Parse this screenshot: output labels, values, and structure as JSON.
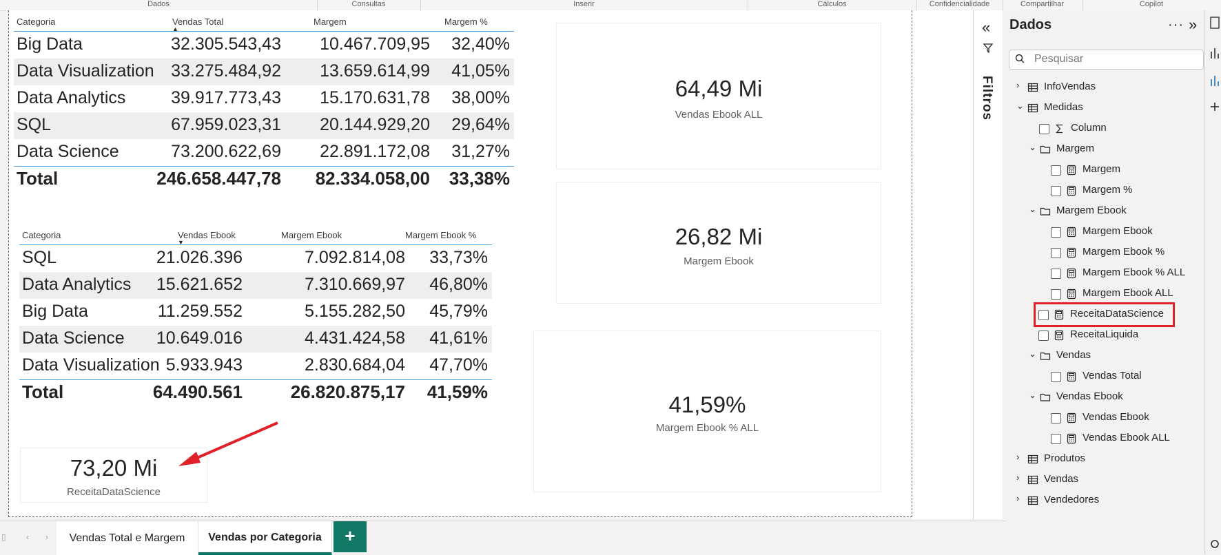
{
  "ribbon": [
    "Dados",
    "Consultas",
    "Inserir",
    "Cálculos",
    "Confidencialidade",
    "Compartilhar",
    "Copilot"
  ],
  "table1": {
    "headers": [
      "Categoria",
      "Vendas Total",
      "Margem",
      "Margem %"
    ],
    "rows": [
      [
        "Big Data",
        "32.305.543,43",
        "10.467.709,95",
        "32,40%"
      ],
      [
        "Data Visualization",
        "33.275.484,92",
        "13.659.614,99",
        "41,05%"
      ],
      [
        "Data Analytics",
        "39.917.773,43",
        "15.170.631,78",
        "38,00%"
      ],
      [
        "SQL",
        "67.959.023,31",
        "20.144.929,20",
        "29,64%"
      ],
      [
        "Data Science",
        "73.200.622,69",
        "22.891.172,08",
        "31,27%"
      ]
    ],
    "total": [
      "Total",
      "246.658.447,78",
      "82.334.058,00",
      "33,38%"
    ]
  },
  "table2": {
    "headers": [
      "Categoria",
      "Vendas Ebook",
      "Margem Ebook",
      "Margem Ebook %"
    ],
    "rows": [
      [
        "SQL",
        "21.026.396",
        "7.092.814,08",
        "33,73%"
      ],
      [
        "Data Analytics",
        "15.621.652",
        "7.310.669,97",
        "46,80%"
      ],
      [
        "Big Data",
        "11.259.552",
        "5.155.282,50",
        "45,79%"
      ],
      [
        "Data Science",
        "10.649.016",
        "4.431.424,58",
        "41,61%"
      ],
      [
        "Data Visualization",
        "5.933.943",
        "2.830.684,04",
        "47,70%"
      ]
    ],
    "total": [
      "Total",
      "64.490.561",
      "26.820.875,17",
      "41,59%"
    ]
  },
  "cards": {
    "vendas_ebook_all": {
      "value": "64,49 Mi",
      "label": "Vendas Ebook ALL"
    },
    "margem_ebook": {
      "value": "26,82 Mi",
      "label": "Margem Ebook"
    },
    "margem_ebook_pct_all": {
      "value": "41,59%",
      "label": "Margem Ebook % ALL"
    },
    "receita_data_science": {
      "value": "73,20 Mi",
      "label": "ReceitaDataScience"
    }
  },
  "filters": {
    "label": "Filtros"
  },
  "data_pane": {
    "title": "Dados",
    "more": "···",
    "search_placeholder": "Pesquisar",
    "tree": [
      {
        "label": "InfoVendas",
        "expander": "›"
      },
      {
        "label": "Medidas",
        "expander": "⌄"
      },
      {
        "label": "Column"
      },
      {
        "label": "Margem",
        "expander": "⌄"
      },
      {
        "label": "Margem"
      },
      {
        "label": "Margem %"
      },
      {
        "label": "Margem Ebook",
        "expander": "⌄"
      },
      {
        "label": "Margem Ebook"
      },
      {
        "label": "Margem Ebook %"
      },
      {
        "label": "Margem Ebook % ALL"
      },
      {
        "label": "Margem Ebook ALL"
      },
      {
        "label": "ReceitaDataScience"
      },
      {
        "label": "ReceitaLiquida"
      },
      {
        "label": "Vendas",
        "expander": "⌄"
      },
      {
        "label": "Vendas Total"
      },
      {
        "label": "Vendas Ebook",
        "expander": "⌄"
      },
      {
        "label": "Vendas Ebook"
      },
      {
        "label": "Vendas Ebook ALL"
      },
      {
        "label": "Produtos",
        "expander": "›"
      },
      {
        "label": "Vendas",
        "expander": "›"
      },
      {
        "label": "Vendedores",
        "expander": "›"
      }
    ]
  },
  "tabs": [
    {
      "label": "Vendas Total e Margem"
    },
    {
      "label": "Vendas por Categoria",
      "active": true
    }
  ],
  "add_tab": "+",
  "colors": {
    "accent": "#117865",
    "highlight": "#e0212a",
    "table_rule": "#4da3e0"
  }
}
